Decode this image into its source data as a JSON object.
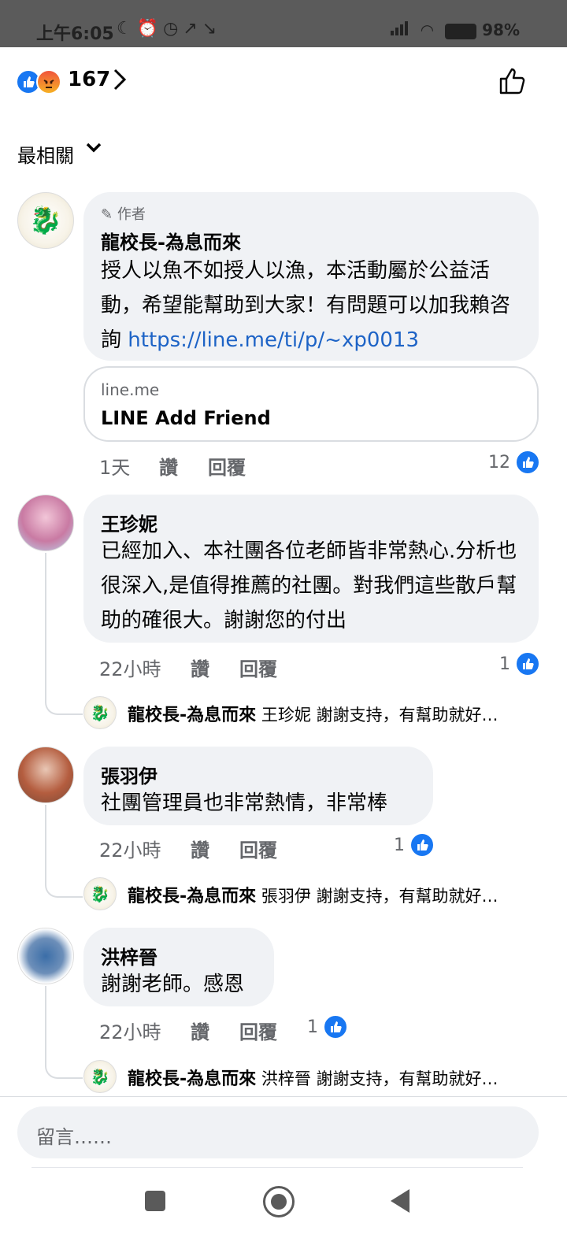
{
  "status_bar": {
    "time": "上午6:05",
    "icons": [
      "moon-icon",
      "alarm-icon",
      "alarm-icon",
      "trend-icon",
      "trend-down-icon"
    ],
    "battery": "98%"
  },
  "reactions": {
    "count": "167",
    "types": [
      "like",
      "angry"
    ]
  },
  "sort": {
    "label": "最相關"
  },
  "comments": [
    {
      "author_tag": "作者",
      "name": "龍校長-為息而來",
      "text": "授人以魚不如授人以漁，本活動屬於公益活動，希望能幫助到大家！有問題可以加我賴咨詢 ",
      "link": "https://line.me/ti/p/~xp0013",
      "card": {
        "domain": "line.me",
        "title": "LINE Add Friend"
      },
      "time": "1天",
      "like_label": "讚",
      "reply_label": "回覆",
      "likes": "12"
    },
    {
      "name": "王珍妮",
      "text": "已經加入、本社團各位老師皆非常熱心.分析也很深入,是值得推薦的社團。對我們這些散戶幫助的確很大。謝謝您的付出",
      "time": "22小時",
      "like_label": "讚",
      "reply_label": "回覆",
      "likes": "1",
      "reply": {
        "name": "龍校長-為息而來",
        "text": "王珍妮 謝謝支持，有幫助就好…"
      }
    },
    {
      "name": "張羽伊",
      "text": "社團管理員也非常熱情，非常棒",
      "time": "22小時",
      "like_label": "讚",
      "reply_label": "回覆",
      "likes": "1",
      "reply": {
        "name": "龍校長-為息而來",
        "text": "張羽伊 謝謝支持，有幫助就好…"
      }
    },
    {
      "name": "洪梓晉",
      "text": "謝謝老師。感恩",
      "time": "22小時",
      "like_label": "讚",
      "reply_label": "回覆",
      "likes": "1",
      "reply": {
        "name": "龍校長-為息而來",
        "text": "洪梓晉 謝謝支持，有幫助就好…"
      }
    }
  ],
  "input": {
    "placeholder": "留言……"
  },
  "colors": {
    "accent": "#1877f2",
    "link": "#1d63c6",
    "bubble": "#f0f2f5"
  }
}
